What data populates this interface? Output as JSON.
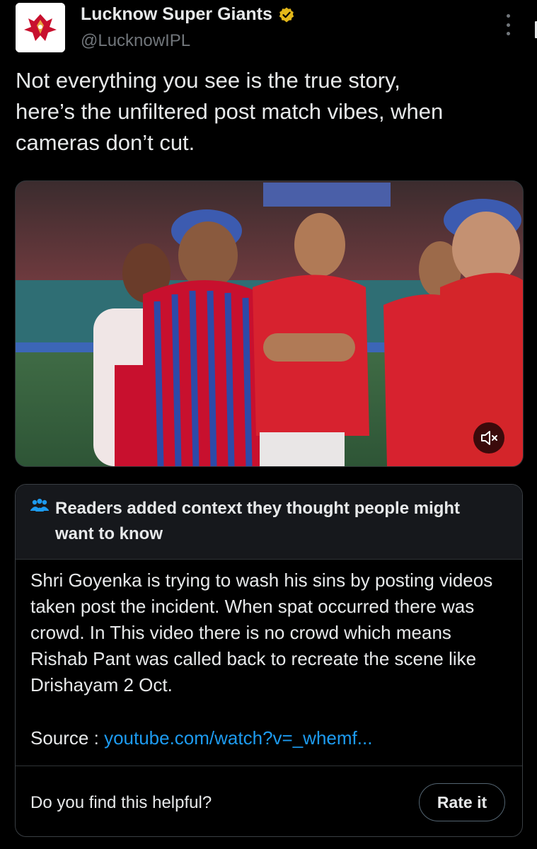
{
  "post": {
    "display_name": "Lucknow Super Giants",
    "handle": "@LucknowIPL",
    "avatar_icon": "lsg-logo",
    "verified_icon": "gold-verified-badge",
    "text": "Not everything you see is the true story,\nhere’s the unfiltered post match vibes, when\ncameras don’t cut.",
    "media_icon": "muted-speaker-icon"
  },
  "community_note": {
    "title": "Readers added context they thought people might want to know",
    "body": "Shri Goyenka is trying to wash his sins by posting videos taken post the incident.  When spat occurred there was crowd. In This video there is no crowd which means Rishab Pant was called back to recreate the scene like Drishayam 2 Oct.",
    "source_label": "Source : ",
    "source_link": "youtube.com/watch?v=_whemf...",
    "helpful_question": "Do you find this helpful?",
    "rate_button": "Rate it"
  },
  "colors": {
    "background": "#000000",
    "text": "#e7e9ea",
    "secondary": "#71767b",
    "link": "#1d9bf0",
    "verified": "#e2b719",
    "brand_red": "#c8102e"
  }
}
